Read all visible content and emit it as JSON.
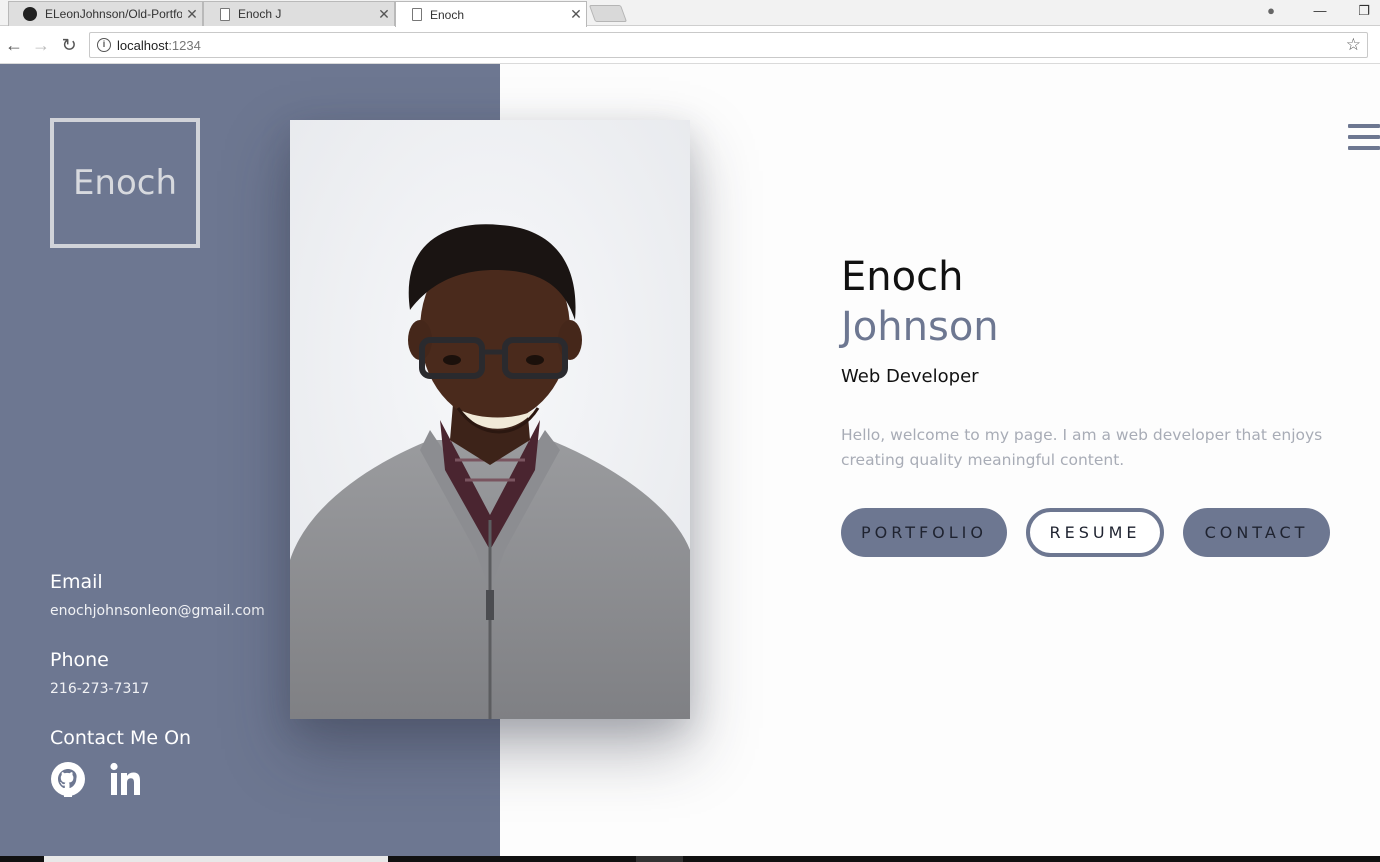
{
  "browser": {
    "tabs": [
      {
        "title": "ELeonJohnson/Old-Portfo",
        "favicon": "github-icon",
        "active": false
      },
      {
        "title": "Enoch J",
        "favicon": "page-icon",
        "active": false
      },
      {
        "title": "Enoch",
        "favicon": "page-icon",
        "active": true
      }
    ],
    "url_host": "localhost",
    "url_port": ":1234",
    "close_glyph": "✕",
    "back_glyph": "←",
    "forward_glyph": "→",
    "reload_glyph": "↻",
    "star_glyph": "☆",
    "minimize_glyph": "—",
    "restore_glyph": "❐",
    "profile_glyph": "●"
  },
  "sidebar": {
    "logo": "Enoch",
    "email_heading": "Email",
    "email_value": "enochjohnsonleon@gmail.com",
    "phone_heading": "Phone",
    "phone_value": "216-273-7317",
    "social_heading": "Contact Me On",
    "social_icons": [
      "github-icon",
      "linkedin-icon"
    ]
  },
  "hero": {
    "first_name": "Enoch",
    "last_name": "Johnson",
    "role": "Web Developer",
    "intro": "Hello, welcome to my page. I am a web developer that enjoys creating quality meaningful content.",
    "buttons": {
      "portfolio": "PORTFOLIO",
      "resume": "RESUME",
      "contact": "CONTACT"
    }
  },
  "colors": {
    "accent": "#6d7791",
    "background": "#fdfdfd",
    "muted_text": "#a8acb6"
  }
}
